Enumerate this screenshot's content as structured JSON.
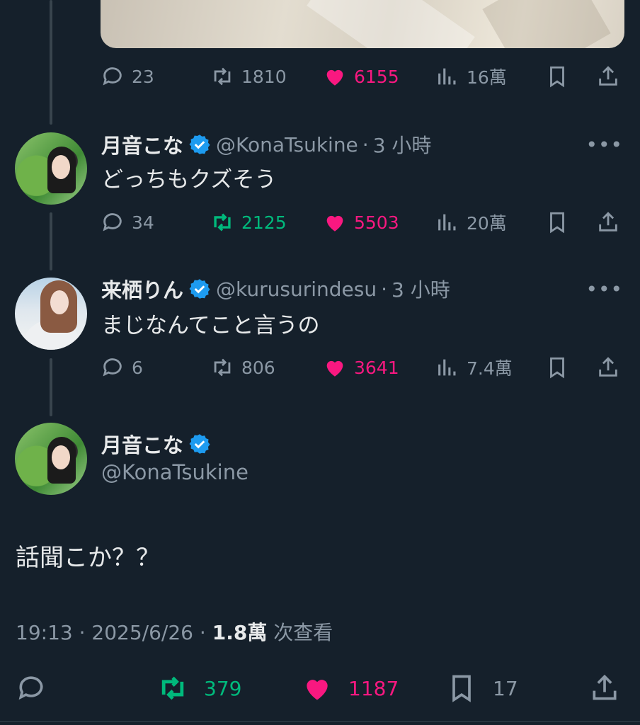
{
  "colors": {
    "background": "#15202b",
    "muted": "#8b98a5",
    "like": "#f91880",
    "retweet": "#00ba7c",
    "verified": "#1d9bf0"
  },
  "top_post": {
    "replies": "23",
    "retweets": "1810",
    "likes": "6155",
    "views": "16萬",
    "liked": true,
    "retweeted": false
  },
  "reply1": {
    "name": "月音こな",
    "handle": "@KonaTsukine",
    "time": "3 小時",
    "text": "どっちもクズそう",
    "replies": "34",
    "retweets": "2125",
    "likes": "5503",
    "views": "20萬",
    "liked": true,
    "retweeted": true
  },
  "reply2": {
    "name": "来栖りん",
    "handle": "@kurusurindesu",
    "time": "3 小時",
    "text": "まじなんてこと言うの",
    "replies": "6",
    "retweets": "806",
    "likes": "3641",
    "views": "7.4萬",
    "liked": true,
    "retweeted": false
  },
  "main": {
    "name": "月音こな",
    "handle": "@KonaTsukine",
    "text": "話聞こか？？",
    "time": "19:13",
    "date": "2025/6/26",
    "views": "1.8萬",
    "views_suffix": "次查看",
    "retweets": "379",
    "likes": "1187",
    "bookmarks": "17"
  },
  "icons": [
    "reply-icon",
    "retweet-icon",
    "like-icon",
    "views-icon",
    "bookmark-icon",
    "share-icon",
    "verified-icon",
    "more-icon"
  ],
  "separator": "·",
  "more_label": "•••"
}
